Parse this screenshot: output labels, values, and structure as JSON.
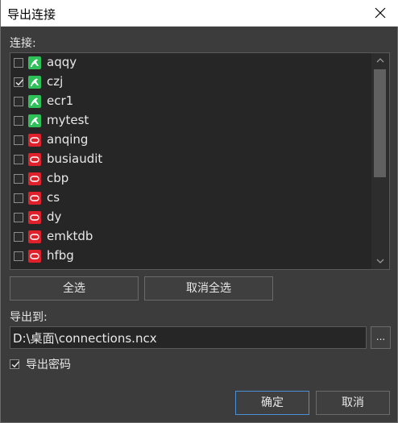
{
  "window": {
    "title": "导出连接"
  },
  "connections_label": "连接:",
  "connections": [
    {
      "name": "aqqy",
      "type": "mysql",
      "checked": false
    },
    {
      "name": "czj",
      "type": "mysql",
      "checked": true
    },
    {
      "name": "ecr1",
      "type": "mysql",
      "checked": false
    },
    {
      "name": "mytest",
      "type": "mysql",
      "checked": false
    },
    {
      "name": "anqing",
      "type": "oracle",
      "checked": false
    },
    {
      "name": "busiaudit",
      "type": "oracle",
      "checked": false
    },
    {
      "name": "cbp",
      "type": "oracle",
      "checked": false
    },
    {
      "name": "cs",
      "type": "oracle",
      "checked": false
    },
    {
      "name": "dy",
      "type": "oracle",
      "checked": false
    },
    {
      "name": "emktdb",
      "type": "oracle",
      "checked": false
    },
    {
      "name": "hfbg",
      "type": "oracle",
      "checked": false
    }
  ],
  "buttons": {
    "select_all": "全选",
    "deselect_all": "取消全选",
    "ok": "确定",
    "cancel": "取消",
    "browse": "..."
  },
  "export_to": {
    "label": "导出到:",
    "value": "D:\\桌面\\connections.ncx"
  },
  "export_password": {
    "label": "导出密码",
    "checked": true
  },
  "colors": {
    "mysql_icon": "#2ec15a",
    "oracle_icon": "#e0202a",
    "primary_border": "#4a90d9"
  }
}
